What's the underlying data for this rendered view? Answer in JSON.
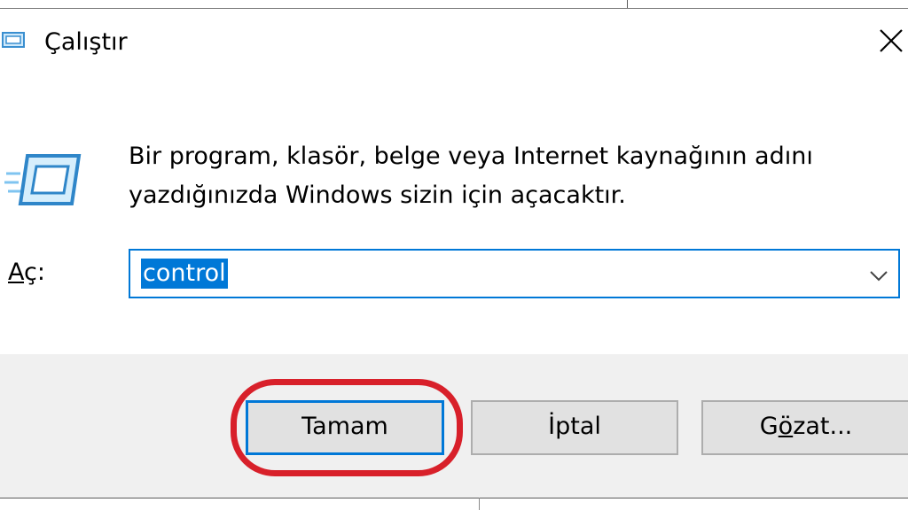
{
  "window": {
    "title": "Çalıştır",
    "close_icon": "close-icon"
  },
  "message": {
    "line1": "Bir program, klasör, belge veya Internet kaynağının adını",
    "line2": "yazdığınızda Windows sizin için açacaktır."
  },
  "open_field": {
    "label_first": "A",
    "label_rest": "ç:",
    "value": "control",
    "dropdown_icon": "chevron-down-icon"
  },
  "buttons": {
    "ok": "Tamam",
    "cancel": "İptal",
    "browse_pre": "G",
    "browse_ul": "ö",
    "browse_post": "zat..."
  },
  "colors": {
    "accent": "#0078d7",
    "highlight": "#d8202a",
    "button_bg": "#e1e1e1",
    "footer_bg": "#f0f0f0"
  }
}
